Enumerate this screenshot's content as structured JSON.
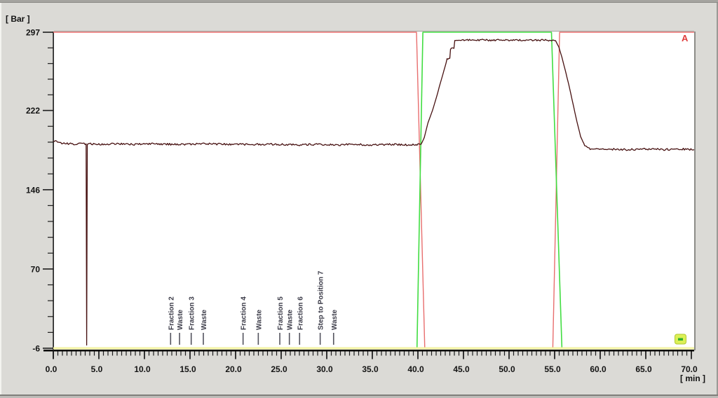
{
  "window": {
    "background": "#dbdad6"
  },
  "chart_data": {
    "type": "line",
    "title": "",
    "ylabel": "[ Bar ]",
    "xlabel": "[ min ]",
    "right_label": "A",
    "xlim": [
      0,
      70
    ],
    "ylim": [
      -6,
      297
    ],
    "grid": "off",
    "legend": "none",
    "x_minor_step": 0.5,
    "y_minor_per_gap": 4,
    "x_ticks": [
      {
        "value": 0,
        "label": "0.0"
      },
      {
        "value": 5,
        "label": "5.0"
      },
      {
        "value": 10,
        "label": "10.0"
      },
      {
        "value": 15,
        "label": "15.0"
      },
      {
        "value": 20,
        "label": "20.0"
      },
      {
        "value": 25,
        "label": "25.0"
      },
      {
        "value": 30,
        "label": "30.0"
      },
      {
        "value": 35,
        "label": "35.0"
      },
      {
        "value": 40,
        "label": "40.0"
      },
      {
        "value": 45,
        "label": "45.0"
      },
      {
        "value": 50,
        "label": "50.0"
      },
      {
        "value": 55,
        "label": "55.0"
      },
      {
        "value": 60,
        "label": "60.0"
      },
      {
        "value": 65,
        "label": "65.0"
      },
      {
        "value": 70,
        "label": "70.0"
      }
    ],
    "y_ticks": [
      {
        "value": 297,
        "label": "297"
      },
      {
        "value": 222,
        "label": "222"
      },
      {
        "value": 146,
        "label": "146"
      },
      {
        "value": 70,
        "label": "70"
      },
      {
        "value": -6,
        "label": "-6"
      }
    ],
    "events": [
      {
        "x": 12.87,
        "label": "Fraction 2"
      },
      {
        "x": 13.85,
        "label": "Waste"
      },
      {
        "x": 15.13,
        "label": "Fraction 3"
      },
      {
        "x": 16.46,
        "label": "Waste"
      },
      {
        "x": 20.82,
        "label": "Fraction 4"
      },
      {
        "x": 22.49,
        "label": "Waste"
      },
      {
        "x": 24.85,
        "label": "Fraction 5"
      },
      {
        "x": 25.9,
        "label": "Waste"
      },
      {
        "x": 27.02,
        "label": "Fraction 6"
      },
      {
        "x": 29.28,
        "label": "Step to Position 7"
      },
      {
        "x": 30.75,
        "label": "Waste"
      }
    ],
    "series": [
      {
        "name": "curve-red",
        "color": "#e86e6e",
        "width": 1.4,
        "noise": 0,
        "points": [
          [
            0,
            297
          ],
          [
            39.85,
            297
          ],
          [
            40.75,
            -6
          ],
          [
            54.8,
            -6
          ],
          [
            55.55,
            297
          ],
          [
            70.3,
            297
          ]
        ]
      },
      {
        "name": "curve-green",
        "color": "#41dd41",
        "width": 1.6,
        "noise": 0,
        "points": [
          [
            0,
            -6
          ],
          [
            39.9,
            -6
          ],
          [
            40.55,
            297
          ],
          [
            54.65,
            297
          ],
          [
            55.8,
            -6
          ],
          [
            70.3,
            -6
          ]
        ]
      },
      {
        "name": "baseline-yellow",
        "color": "#f1f1a2",
        "width": 3,
        "noise": 0,
        "points": [
          [
            0,
            -6
          ],
          [
            70.3,
            -6
          ]
        ]
      },
      {
        "name": "system-pressure",
        "color": "#471111",
        "width": 1.3,
        "noise": 0.9,
        "points": [
          [
            0,
            192
          ],
          [
            0.35,
            193
          ],
          [
            0.7,
            190.5
          ],
          [
            2,
            190
          ],
          [
            3.6,
            190
          ],
          [
            3.66,
            -3
          ],
          [
            3.73,
            190
          ],
          [
            5,
            189.5
          ],
          [
            7,
            190
          ],
          [
            9,
            189.5
          ],
          [
            11,
            190
          ],
          [
            13,
            189.5
          ],
          [
            15,
            189.5
          ],
          [
            17,
            190
          ],
          [
            19,
            189.5
          ],
          [
            21,
            189.5
          ],
          [
            23,
            189.5
          ],
          [
            25,
            189.5
          ],
          [
            27,
            189
          ],
          [
            29,
            189.5
          ],
          [
            31,
            189
          ],
          [
            33,
            189.5
          ],
          [
            35,
            189
          ],
          [
            37,
            189.5
          ],
          [
            39,
            189
          ],
          [
            40.35,
            189.5
          ],
          [
            40.7,
            196
          ],
          [
            41.1,
            210
          ],
          [
            41.6,
            222
          ],
          [
            42.05,
            235
          ],
          [
            42.45,
            248
          ],
          [
            42.85,
            260
          ],
          [
            43.2,
            271
          ],
          [
            43.5,
            272
          ],
          [
            43.58,
            281
          ],
          [
            43.95,
            281.5
          ],
          [
            44.05,
            288.5
          ],
          [
            44.5,
            289.5
          ],
          [
            46,
            289.5
          ],
          [
            48,
            289.5
          ],
          [
            50,
            289.5
          ],
          [
            52,
            289.5
          ],
          [
            54,
            289.5
          ],
          [
            55.1,
            289
          ],
          [
            55.45,
            283
          ],
          [
            55.8,
            273
          ],
          [
            56.15,
            261
          ],
          [
            56.55,
            247
          ],
          [
            57,
            229
          ],
          [
            57.45,
            211
          ],
          [
            57.85,
            197
          ],
          [
            58.2,
            190
          ],
          [
            58.6,
            186
          ],
          [
            59,
            185
          ],
          [
            61,
            185
          ],
          [
            63,
            184.5
          ],
          [
            65,
            185
          ],
          [
            67,
            184.5
          ],
          [
            69,
            185
          ],
          [
            70.3,
            184.5
          ]
        ]
      }
    ],
    "marker_badge": {
      "fill": "#dbf055",
      "border": "#b2c733",
      "dash_color": "#2fae2f"
    }
  }
}
